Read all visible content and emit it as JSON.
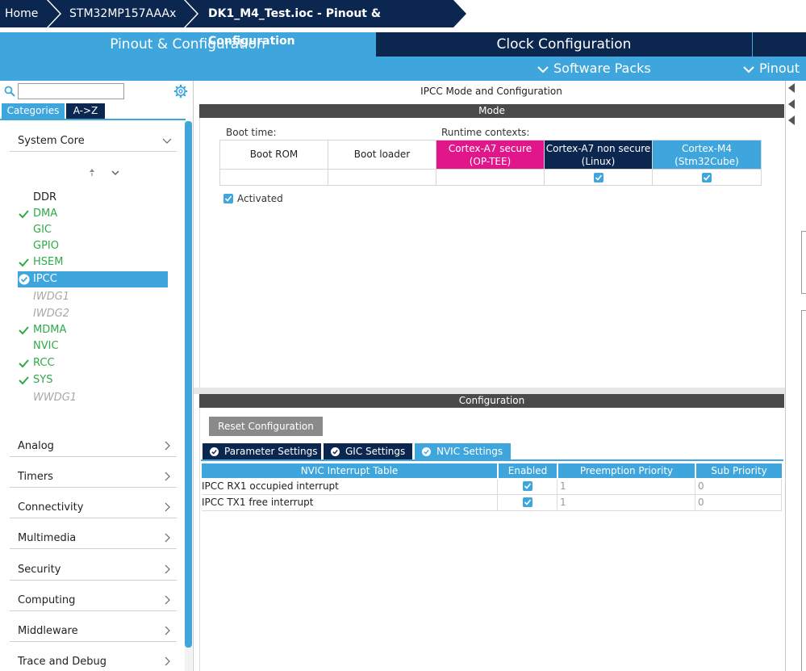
{
  "breadcrumb": [
    "Home",
    "STM32MP157AAAx",
    "DK1_M4_Test.ioc - Pinout & Configuration"
  ],
  "main_tabs": {
    "pinout": "Pinout & Configuration",
    "clock": "Clock Configuration"
  },
  "subbar": {
    "software_packs": "Software Packs",
    "pinout": "Pinout"
  },
  "sidebar": {
    "search": {
      "value": ""
    },
    "tabs": {
      "categories": "Categories",
      "az": "A->Z"
    },
    "system_core": "System Core",
    "peripherals": [
      {
        "label": "DDR",
        "state": "none"
      },
      {
        "label": "DMA",
        "state": "enabled"
      },
      {
        "label": "GIC",
        "state": "available"
      },
      {
        "label": "GPIO",
        "state": "available"
      },
      {
        "label": "HSEM",
        "state": "enabled"
      },
      {
        "label": "IPCC",
        "state": "selected"
      },
      {
        "label": "IWDG1",
        "state": "disabled"
      },
      {
        "label": "IWDG2",
        "state": "disabled"
      },
      {
        "label": "MDMA",
        "state": "enabled"
      },
      {
        "label": "NVIC",
        "state": "available"
      },
      {
        "label": "RCC",
        "state": "enabled"
      },
      {
        "label": "SYS",
        "state": "enabled"
      },
      {
        "label": "WWDG1",
        "state": "disabled"
      }
    ],
    "categories": [
      "Analog",
      "Timers",
      "Connectivity",
      "Multimedia",
      "Security",
      "Computing",
      "Middleware",
      "Trace and Debug"
    ]
  },
  "panel": {
    "title": "IPCC Mode and Configuration",
    "mode_header": "Mode",
    "boot_time_label": "Boot time:",
    "runtime_label": "Runtime contexts:",
    "boot_rom": "Boot ROM",
    "boot_loader": "Boot loader",
    "a7_secure": [
      "Cortex-A7 secure",
      "(OP-TEE)"
    ],
    "a7_nonsecure": [
      "Cortex-A7 non secure",
      "(Linux)"
    ],
    "m4": [
      "Cortex-M4",
      "(Stm32Cube)"
    ],
    "activated_label": "Activated",
    "config_header": "Configuration",
    "reset_button": "Reset Configuration",
    "config_tabs": [
      "Parameter Settings",
      "GIC Settings",
      "NVIC Settings"
    ],
    "nvic_table": {
      "headers": [
        "NVIC Interrupt Table",
        "Enabled",
        "Preemption Priority",
        "Sub Priority"
      ],
      "rows": [
        {
          "name": "IPCC RX1 occupied interrupt",
          "enabled": true,
          "preemption": "1",
          "sub": "0"
        },
        {
          "name": "IPCC TX1 free interrupt",
          "enabled": true,
          "preemption": "1",
          "sub": "0"
        }
      ]
    }
  },
  "colors": {
    "accent": "#3ea6dc",
    "navy": "#0b2750",
    "magenta": "#e2168b",
    "green": "#2faa4a"
  }
}
